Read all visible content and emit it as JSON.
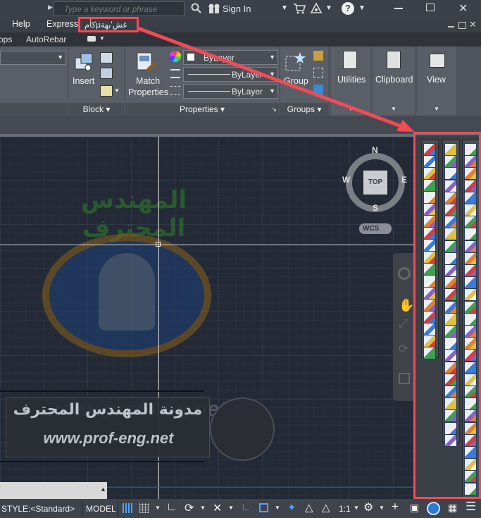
{
  "topbar": {
    "search_placeholder": "Type a keyword or phrase",
    "sign_in": "Sign In",
    "help_icon": "?"
  },
  "menubar": {
    "items": [
      "Help",
      "Express",
      "كأمµغش'بهة"
    ]
  },
  "ribbon_tabs": [
    "ops",
    "AutoRebar"
  ],
  "ribbon": {
    "block": {
      "insert_label": "Insert",
      "title": "Block"
    },
    "properties": {
      "match_label_1": "Match",
      "match_label_2": "Properties",
      "color_value": "ByLayer",
      "linetype_value": "ByLayer",
      "lineweight_value": "ByLayer",
      "title": "Properties"
    },
    "groups": {
      "group_label": "Group",
      "title": "Groups"
    },
    "utilities_label": "Utilities",
    "clipboard_label": "Clipboard",
    "view_label": "View"
  },
  "viewcube": {
    "north": "N",
    "south": "S",
    "east": "E",
    "west": "W",
    "top": "TOP",
    "wcs": "WCS"
  },
  "watermark": {
    "arabic_title": "المهندس المحترف",
    "url": "www.prof-eng.net",
    "arabic_blog": "مدونة المهندس المحترف"
  },
  "statusbar": {
    "style_text": "STYLE:<Standard>",
    "model_label": "MODEL",
    "scale_label": "1:1"
  },
  "colors": {
    "highlight": "#f14b55",
    "accent_blue": "#4aa3ff",
    "canvas_bg": "#232a36",
    "ribbon_bg": "#50555d"
  },
  "icons": {
    "search": "magnifier-icon",
    "sign_in": "binoculars-person-icon",
    "cart": "cart-icon",
    "a360": "a360-icon",
    "help": "help-circle-icon"
  }
}
